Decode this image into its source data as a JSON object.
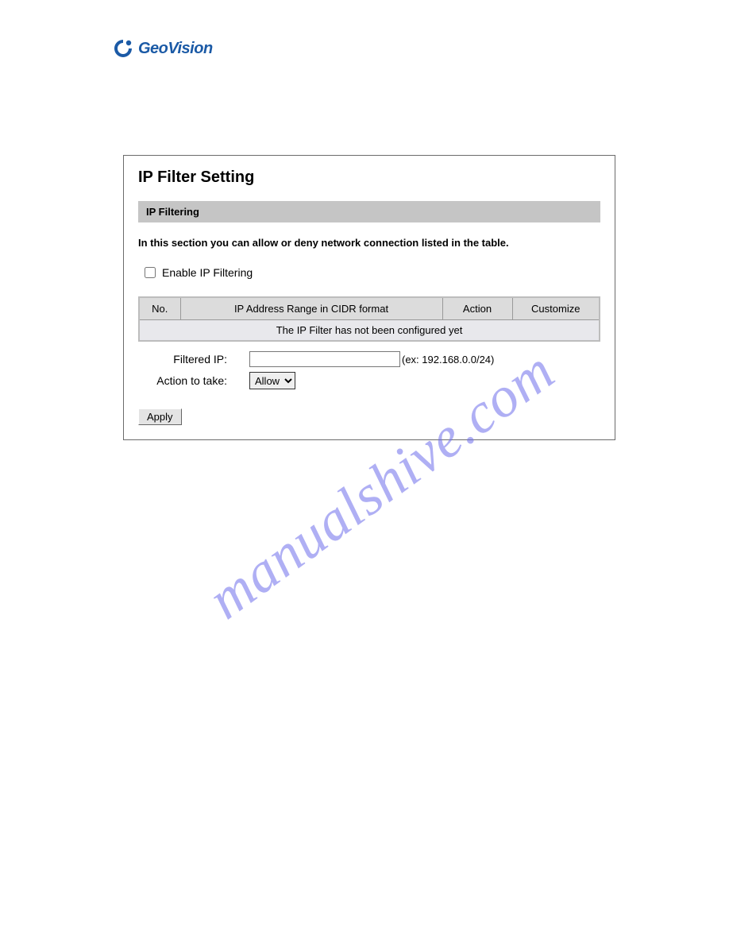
{
  "logo": {
    "brand": "GeoVision"
  },
  "panel": {
    "title": "IP Filter Setting",
    "section_header": "IP Filtering",
    "description": "In this section you can allow or deny network connection listed in the table.",
    "enable_label": "Enable IP Filtering",
    "table": {
      "cols": {
        "no": "No.",
        "range": "IP Address Range in CIDR format",
        "action": "Action",
        "customize": "Customize"
      },
      "empty": "The IP Filter has not been configured yet"
    },
    "form": {
      "filtered_ip_label": "Filtered IP:",
      "filtered_ip_value": "",
      "filtered_ip_hint": "(ex: 192.168.0.0/24)",
      "action_label": "Action to take:",
      "action_selected": "Allow"
    },
    "apply_label": "Apply"
  },
  "watermark": "manualshive.com"
}
